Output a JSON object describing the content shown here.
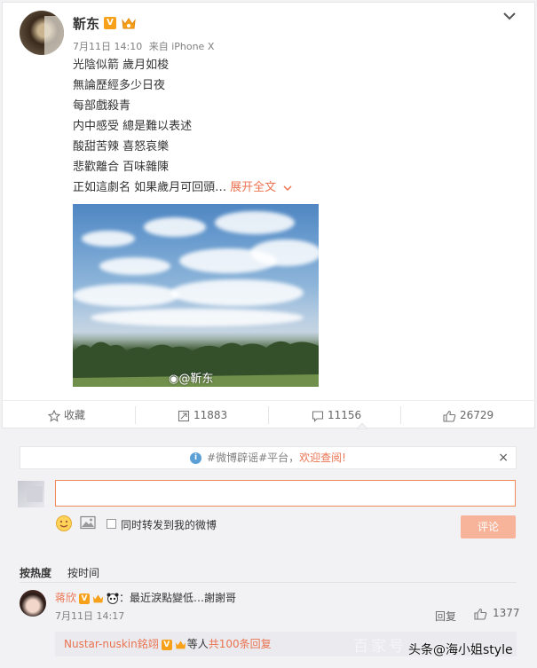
{
  "post": {
    "username": "靳东",
    "v_badge": "V",
    "date": "7月11日 14:10",
    "source": "来自 iPhone X",
    "lines": [
      "光陰似箭 歲月如梭",
      "無論歷經多少日夜",
      "每部戲殺青",
      "内中感受 總是難以表述",
      "酸甜苦辣 喜怒哀樂",
      "悲歡離合 百味雜陳",
      "正如這劇名 如果歲月可回頭…"
    ],
    "expand_label": "展开全文",
    "image_watermark": "@靳东"
  },
  "actions": {
    "favorite": "收藏",
    "reposts": "11883",
    "comments": "11156",
    "likes": "26729"
  },
  "notice": {
    "prefix": "#微博辟谣#平台，",
    "highlight": "欢迎查阅!",
    "close": "×"
  },
  "composer": {
    "input_value": "",
    "repost_label": "同时转发到我的微博",
    "submit_label": "评论"
  },
  "sort": {
    "by_hot": "按热度",
    "by_time": "按时间"
  },
  "comment": {
    "user": "蒋欣",
    "v_badge": "V",
    "text": "：最近淚點變低…謝謝哥",
    "time": "7月11日 14:17",
    "reply_label": "回复",
    "likes": "1377"
  },
  "subreplies": {
    "user": "Nustar-nuskin銘翊",
    "others": "等人",
    "count_text": "共100条回复"
  },
  "overlay": {
    "brand_watermark": "百家号",
    "toutiao_label": "头条@海小姐style"
  },
  "colors": {
    "accent": "#eb7350",
    "badge": "#f7a11b",
    "submit_disabled": "#f7b49a",
    "input_border": "#f08a5d"
  }
}
